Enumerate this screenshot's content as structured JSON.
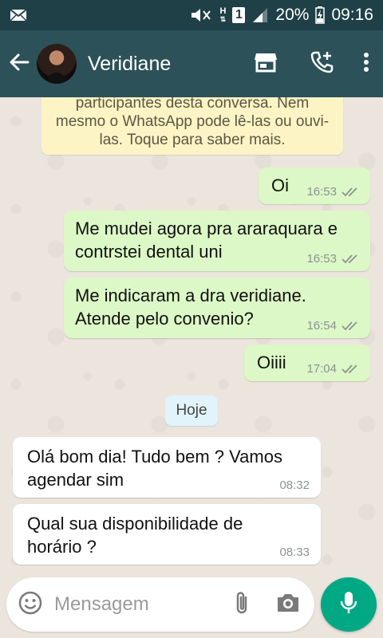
{
  "status_bar": {
    "battery": "20%",
    "time": "09:16",
    "network_label": "H",
    "sim_label": "1",
    "icons": [
      "mail-icon",
      "mute-icon",
      "signal-icon",
      "battery-charging-icon"
    ]
  },
  "header": {
    "contact_name": "Veridiane",
    "icons": [
      "back-arrow-icon",
      "store-icon",
      "add-call-icon",
      "more-vert-icon"
    ]
  },
  "encryption_notice": {
    "lines": [
      "participantes desta conversa. Nem",
      "mesmo o WhatsApp pode lê-las ou ouvi-",
      "las. Toque para saber mais."
    ]
  },
  "messages": [
    {
      "direction": "outgoing",
      "text": "Oi",
      "time": "16:53",
      "status": "read"
    },
    {
      "direction": "outgoing",
      "text": "Me mudei agora pra araraquara e contrstei dental uni",
      "time": "16:53",
      "status": "read"
    },
    {
      "direction": "outgoing",
      "text": "Me indicaram a dra veridiane. Atende pelo convenio?",
      "time": "16:54",
      "status": "read"
    },
    {
      "direction": "outgoing",
      "text": "Oiiii",
      "time": "17:04",
      "status": "read"
    },
    {
      "direction": "incoming",
      "text": "Olá bom dia! Tudo bem ? Vamos agendar sim",
      "time": "08:32"
    },
    {
      "direction": "incoming",
      "text": "Qual sua disponibilidade de horário ?",
      "time": "08:33"
    }
  ],
  "date_divider": "Hoje",
  "composer": {
    "placeholder": "Mensagem",
    "icons": [
      "emoji-icon",
      "attach-icon",
      "camera-icon",
      "mic-icon"
    ]
  },
  "colors": {
    "appbar": "#2c5158",
    "statusbar": "#1f4047",
    "outgoing_bubble": "#dcf8c6",
    "incoming_bubble": "#ffffff",
    "chat_background": "#ece5dd",
    "accent": "#00a884",
    "read_ticks": "#8b9292"
  }
}
